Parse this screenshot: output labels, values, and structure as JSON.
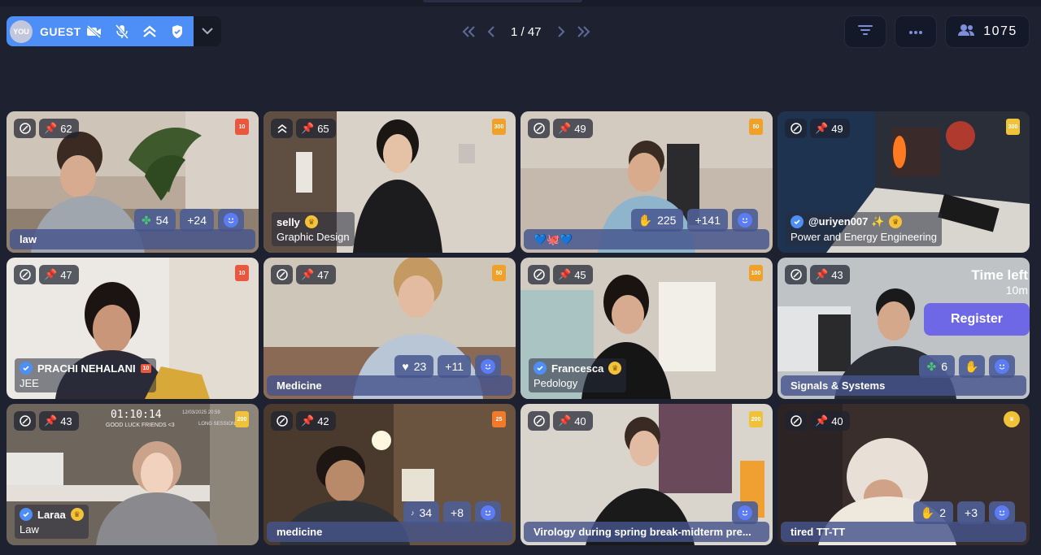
{
  "user": {
    "avatar_label": "YOU",
    "name": "GUEST"
  },
  "pagination": {
    "text": "1 / 47"
  },
  "participants": {
    "count": "1075"
  },
  "tiles": [
    {
      "pin": "62",
      "badge": "10",
      "badge_color": "#e9573f",
      "name": "law",
      "stats": [
        {
          "icon": "clover",
          "value": "54"
        },
        {
          "value": "+24"
        }
      ]
    },
    {
      "pin": "65",
      "badge": "300",
      "badge_color": "#f0a12a",
      "name": "selly",
      "subtitle": "Graphic Design"
    },
    {
      "pin": "49",
      "badge": "50",
      "badge_color": "#f0a12a",
      "name": "💙🐙💙",
      "stats": [
        {
          "icon": "hands",
          "value": "225"
        },
        {
          "value": "+141"
        }
      ]
    },
    {
      "pin": "49",
      "badge": "300",
      "badge_color": "#f0c23a",
      "name": "@uriyen007 ✨",
      "subtitle": "Power and Energy Engineering"
    },
    {
      "pin": "47",
      "badge": "10",
      "badge_color": "#e9573f",
      "name": "PRACHI NEHALANI",
      "name_badge": "10",
      "subtitle": "JEE"
    },
    {
      "pin": "47",
      "badge": "50",
      "badge_color": "#f0a12a",
      "name": "Medicine",
      "stats": [
        {
          "icon": "heart",
          "value": "23"
        },
        {
          "value": "+11"
        }
      ]
    },
    {
      "pin": "45",
      "badge": "100",
      "badge_color": "#f0a12a",
      "name": "Francesca",
      "subtitle": "Pedology"
    },
    {
      "pin": "43",
      "name": "Signals & Systems",
      "time_left_label": "Time left",
      "time_left_value": "10m",
      "register_label": "Register",
      "stats": [
        {
          "icon": "clover",
          "value": "6"
        }
      ]
    },
    {
      "pin": "43",
      "badge": "200",
      "badge_color": "#f0c23a",
      "name": "Laraa",
      "subtitle": "Law",
      "clock": "01:10:14",
      "clock_caption": "GOOD LUCK FRIENDS <3",
      "clock_date": "12/03/2025 20:59",
      "clock_right": "LONG SESSIONS"
    },
    {
      "pin": "42",
      "badge": "25",
      "badge_color": "#f07a2a",
      "name": "medicine",
      "stats": [
        {
          "icon": "note",
          "value": "34"
        },
        {
          "value": "+8"
        }
      ]
    },
    {
      "pin": "40",
      "badge": "200",
      "badge_color": "#f0c23a",
      "name": "Virology during spring break-midterm pre..."
    },
    {
      "pin": "40",
      "name": "tired TT-TT",
      "stats": [
        {
          "icon": "hands",
          "value": "2"
        },
        {
          "value": "+3"
        }
      ]
    }
  ],
  "icons": {
    "camera_off": "camera-off-icon",
    "mic_off": "mic-off-icon",
    "rank": "rank-icon",
    "shield": "shield-icon",
    "chevron_down": "chevron-down-icon",
    "first_page": "double-chevron-left-icon",
    "prev_page": "chevron-left-icon",
    "next_page": "chevron-right-icon",
    "last_page": "double-chevron-right-icon",
    "filter": "filter-icon",
    "more": "more-icon",
    "people": "people-icon"
  },
  "colors": {
    "background": "#1e2230",
    "accent": "#4d8ff7",
    "register": "#6f68e6"
  }
}
